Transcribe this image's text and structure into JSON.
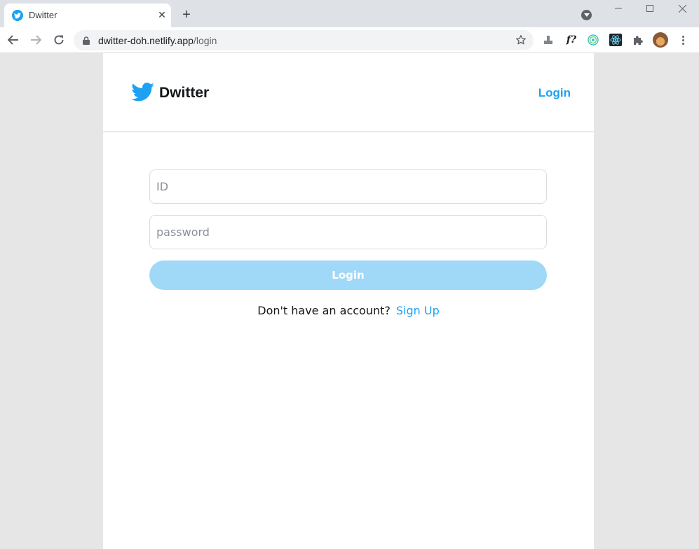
{
  "browser": {
    "tab": {
      "title": "Dwitter",
      "favicon": "twitter-bird-icon"
    },
    "address": {
      "host": "dwitter-doh.netlify.app",
      "path": "/login"
    }
  },
  "app": {
    "brand": "Dwitter",
    "header_login": "Login",
    "brand_color": "#1da1f2",
    "form": {
      "id_placeholder": "ID",
      "password_placeholder": "password",
      "id_value": "",
      "password_value": "",
      "submit_label": "Login"
    },
    "signup_prompt": "Don't have an account?",
    "signup_link": "Sign Up"
  }
}
